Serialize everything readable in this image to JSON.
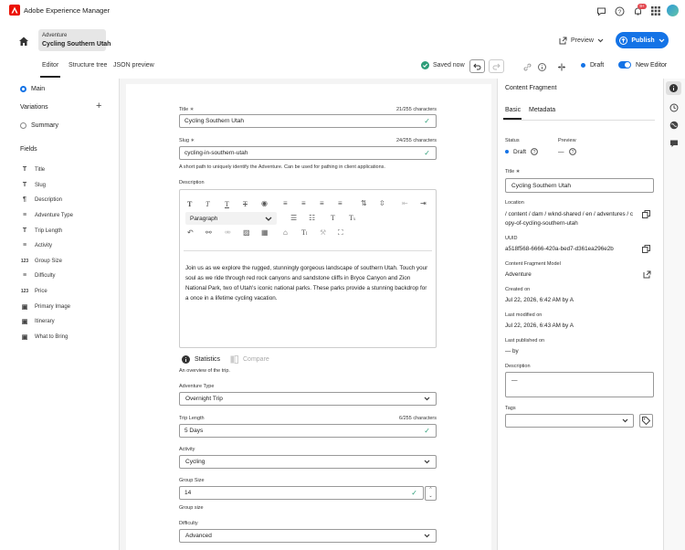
{
  "app": {
    "title": "Adobe Experience Manager"
  },
  "header": {
    "breadcrumb_parent": "Adventure",
    "breadcrumb_title": "Cycling Southern Utah",
    "preview_label": "Preview",
    "publish_label": "Publish"
  },
  "tabs": {
    "editor": "Editor",
    "structure": "Structure tree",
    "json": "JSON preview"
  },
  "toolbar": {
    "saved": "Saved now",
    "status": "Draft",
    "new_editor": "New Editor"
  },
  "notifications": {
    "badge": "9+"
  },
  "left": {
    "main": "Main",
    "variations": "Variations",
    "summary": "Summary",
    "fields_heading": "Fields",
    "fields": [
      {
        "label": "Title",
        "icon": "T"
      },
      {
        "label": "Slug",
        "icon": "T"
      },
      {
        "label": "Description",
        "icon": "¶"
      },
      {
        "label": "Adventure Type",
        "icon": "≡"
      },
      {
        "label": "Trip Length",
        "icon": "T"
      },
      {
        "label": "Activity",
        "icon": "≡"
      },
      {
        "label": "Group Size",
        "icon": "123"
      },
      {
        "label": "Difficulty",
        "icon": "≡"
      },
      {
        "label": "Price",
        "icon": "123"
      },
      {
        "label": "Primary Image",
        "icon": "▣"
      },
      {
        "label": "Itinerary",
        "icon": "▣"
      },
      {
        "label": "What to Bring",
        "icon": "▣"
      }
    ]
  },
  "form": {
    "title_label": "Title",
    "title_counter": "21/255 characters",
    "title_value": "Cycling Southern Utah",
    "slug_label": "Slug",
    "slug_counter": "24/255 characters",
    "slug_value": "cycling-in-southern-utah",
    "slug_help": "A short path to uniquely identify the Adventure. Can be used for pathing in client applications.",
    "description_label": "Description",
    "paragraph_option": "Paragraph",
    "description_text": "Join us as we explore the rugged, stunningly gorgeous landscape of southern Utah. Touch your soul as we ride through red rock canyons and sandstone cliffs in Bryce Canyon and Zion National Park, two of Utah's iconic national parks. These parks provide a stunning backdrop for a once in a lifetime cycling vacation.",
    "statistics": "Statistics",
    "compare": "Compare",
    "description_help": "An overview of the trip.",
    "adventure_type_label": "Adventure Type",
    "adventure_type_value": "Overnight Trip",
    "trip_length_label": "Trip Length",
    "trip_length_counter": "6/255 characters",
    "trip_length_value": "5 Days",
    "activity_label": "Activity",
    "activity_value": "Cycling",
    "group_size_label": "Group Size",
    "group_size_value": "14",
    "group_size_help": "Group size",
    "difficulty_label": "Difficulty",
    "difficulty_value": "Advanced"
  },
  "right": {
    "heading": "Content Fragment",
    "tab_basic": "Basic",
    "tab_metadata": "Metadata",
    "status_label": "Status",
    "preview_label": "Preview",
    "status_value": "Draft",
    "preview_value": "—",
    "title_label": "Title",
    "title_value": "Cycling Southern Utah",
    "location_label": "Location",
    "location_line1": "/ content / dam / wknd-shared / en / adventures / c",
    "location_line2": "opy-of-cycling-southern-utah",
    "uuid_label": "UUID",
    "uuid_value": "a518f568-6666-420a-bed7-d361ea296e2b",
    "model_label": "Content Fragment Model",
    "model_value": "Adventure",
    "created_label": "Created on",
    "created_value": "Jul 22, 2026, 6:42 AM by A",
    "modified_label": "Last modified on",
    "modified_value": "Jul 22, 2026, 6:43 AM by A",
    "published_label": "Last published on",
    "published_value": "— by",
    "description_label": "Description",
    "description_value": "—",
    "tags_label": "Tags"
  },
  "colors": {
    "accent": "#1473e6",
    "success": "#2d9d78",
    "brand": "#eb1000",
    "badge": "#e34850"
  }
}
